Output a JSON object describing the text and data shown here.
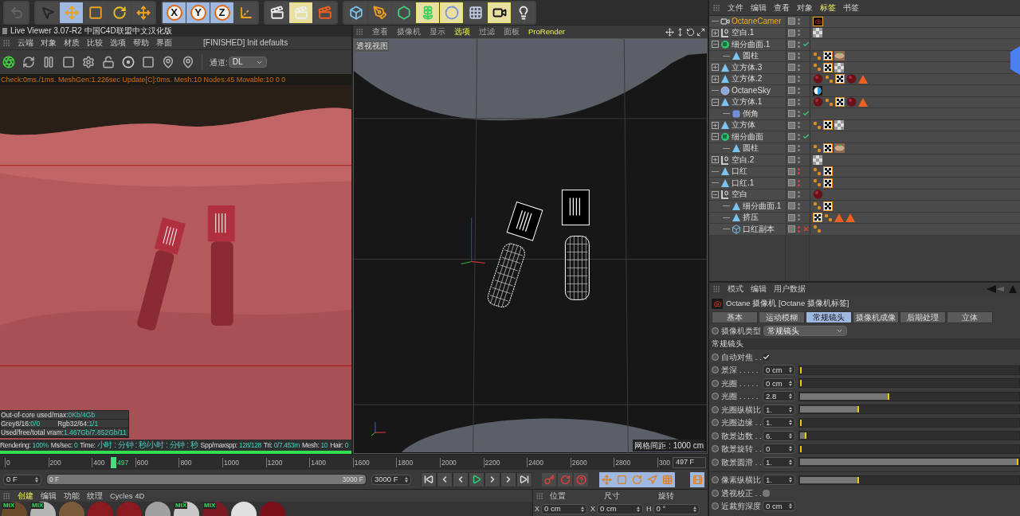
{
  "toolbar": {
    "groups": [
      [
        {
          "kind": "undo",
          "selected": false
        }
      ],
      [
        {
          "kind": "cursor",
          "selected": false
        },
        {
          "kind": "move",
          "selected": true
        },
        {
          "kind": "scale",
          "selected": false
        },
        {
          "kind": "rotate",
          "selected": false
        },
        {
          "kind": "move",
          "selected": false
        }
      ],
      [
        {
          "kind": "axis",
          "label": "X",
          "selected": true
        },
        {
          "kind": "axis",
          "label": "Y",
          "selected": true
        },
        {
          "kind": "axis",
          "label": "Z",
          "selected": true
        },
        {
          "kind": "coords",
          "selected": false
        }
      ],
      [
        {
          "kind": "render",
          "selected": false
        },
        {
          "kind": "render",
          "selected": true
        },
        {
          "kind": "render-settings",
          "selected": false
        }
      ],
      [
        {
          "kind": "cube",
          "selected": false
        },
        {
          "kind": "pen",
          "selected": false
        },
        {
          "kind": "subdivide",
          "selected": false
        },
        {
          "kind": "array",
          "selected": true
        },
        {
          "kind": "deformer",
          "selected": true
        },
        {
          "kind": "floor",
          "selected": false
        },
        {
          "kind": "camera",
          "selected": true
        },
        {
          "kind": "light",
          "selected": false
        }
      ]
    ]
  },
  "live_viewer": {
    "title": "Live Viewer 3.07-R2 中国C4D联盟中文汉化版",
    "menu": [
      "云端",
      "对象",
      "材质",
      "比较",
      "选项",
      "帮助",
      "界面"
    ],
    "status": "[FINISHED] Init defaults",
    "channel": {
      "label": "通道:",
      "value": "DL"
    },
    "stats": "Check:0ms./1ms. MeshGen:1.226sec Update[C]:0ms. Mesh:10 Nodes:45 Movable:10  0 0",
    "overlay": [
      [
        {
          "label": "Out-of-core used/max:",
          "value": "0Kb/4Gb"
        }
      ],
      [
        {
          "label": "Grey8/16:",
          "value": "0/0"
        },
        {
          "label": "Rgb32/64:",
          "value": "1/1"
        }
      ],
      [
        {
          "label": "Used/free/total vram:",
          "value": "1.467Gb/7.852Gb/11"
        }
      ]
    ],
    "status_bar": [
      {
        "label": "Rendering:",
        "value": "100%"
      },
      {
        "label": "Ms/sec:",
        "value": "0"
      },
      {
        "label": "Time:",
        "value": "小时 : 分钟 : 秒/小时 : 分钟 : 秒"
      },
      {
        "label": "Spp/maxspp:",
        "value": "128/128"
      },
      {
        "label": "Tri:",
        "value": "0/7.453m"
      },
      {
        "label": "Mesh:",
        "value": "10"
      },
      {
        "label": "Hair:",
        "value": "0"
      }
    ],
    "progress": {
      "level": 1
    }
  },
  "viewport": {
    "menu": [
      {
        "label": "查看",
        "highlighted": false
      },
      {
        "label": "摄像机",
        "highlighted": false
      },
      {
        "label": "显示",
        "highlighted": false
      },
      {
        "label": "选项",
        "highlighted": true
      },
      {
        "label": "过滤",
        "highlighted": false
      },
      {
        "label": "面板",
        "highlighted": false
      },
      {
        "label": "ProRender",
        "highlighted": true
      }
    ],
    "view_name": "透视视图",
    "grid_spacing": "网格间距 : 1000 cm"
  },
  "objects": {
    "menu": [
      {
        "label": "文件",
        "selected": false
      },
      {
        "label": "编辑",
        "selected": false
      },
      {
        "label": "查看",
        "selected": false
      },
      {
        "label": "对象",
        "selected": false
      },
      {
        "label": "标签",
        "selected": true
      },
      {
        "label": "书签",
        "selected": false
      }
    ],
    "items": [
      {
        "name": "OctaneCamer",
        "kind": "camera",
        "selected": true,
        "hidden": false,
        "tags": [
          {
            "kind": "camera"
          }
        ]
      },
      {
        "name": "空白.1",
        "kind": "null",
        "expanded": false,
        "selected": false,
        "hidden": false,
        "tags": [
          {
            "kind": "checker-grey"
          }
        ]
      },
      {
        "name": "细分曲面.1",
        "kind": "subdiv",
        "expanded": true,
        "enabled": true,
        "selected": false,
        "hidden": false,
        "children": [
          {
            "name": "圆柱",
            "kind": "poly",
            "selected": false,
            "hidden": false,
            "tags": [
              {
                "kind": "dots"
              },
              {
                "kind": "checker"
              },
              {
                "kind": "material-brown"
              }
            ]
          }
        ]
      },
      {
        "name": "立方体.3",
        "kind": "poly",
        "expanded": false,
        "selected": false,
        "hidden": false,
        "tags": [
          {
            "kind": "dots"
          },
          {
            "kind": "checker"
          },
          {
            "kind": "checker-grey"
          }
        ]
      },
      {
        "name": "立方体.2",
        "kind": "poly",
        "expanded": false,
        "selected": false,
        "hidden": false,
        "tags": [
          {
            "kind": "sphere-red"
          },
          {
            "kind": "dots"
          },
          {
            "kind": "checker"
          },
          {
            "kind": "sphere-red"
          },
          {
            "kind": "triangle"
          }
        ]
      },
      {
        "name": "OctaneSky",
        "kind": "sky",
        "selected": false,
        "hidden": false,
        "tags": [
          {
            "kind": "sky"
          }
        ]
      },
      {
        "name": "立方体.1",
        "kind": "poly",
        "expanded": true,
        "selected": false,
        "hidden": false,
        "tags": [
          {
            "kind": "sphere-red"
          },
          {
            "kind": "dots"
          },
          {
            "kind": "checker"
          },
          {
            "kind": "sphere-red"
          },
          {
            "kind": "triangle"
          }
        ],
        "children": [
          {
            "name": "倒角",
            "kind": "bevel",
            "enabled": true,
            "selected": false,
            "hidden": false
          }
        ]
      },
      {
        "name": "立方体",
        "kind": "poly",
        "expanded": false,
        "selected": false,
        "hidden": false,
        "tags": [
          {
            "kind": "dots"
          },
          {
            "kind": "checker"
          },
          {
            "kind": "checker-grey"
          }
        ]
      },
      {
        "name": "细分曲面",
        "kind": "subdiv",
        "expanded": true,
        "enabled": true,
        "selected": false,
        "hidden": false,
        "children": [
          {
            "name": "圆柱",
            "kind": "poly",
            "selected": false,
            "hidden": false,
            "tags": [
              {
                "kind": "dots"
              },
              {
                "kind": "checker"
              },
              {
                "kind": "material-brown"
              }
            ]
          }
        ]
      },
      {
        "name": "空白.2",
        "kind": "null",
        "expanded": false,
        "selected": false,
        "hidden": false,
        "tags": [
          {
            "kind": "checker-grey"
          }
        ]
      },
      {
        "name": "口红",
        "kind": "poly",
        "selected": false,
        "hidden": true,
        "tags": [
          {
            "kind": "dots"
          },
          {
            "kind": "checker"
          }
        ]
      },
      {
        "name": "口红.1",
        "kind": "poly",
        "selected": false,
        "hidden": true,
        "tags": [
          {
            "kind": "dots"
          },
          {
            "kind": "checker"
          }
        ]
      },
      {
        "name": "空白",
        "kind": "null",
        "expanded": true,
        "selected": false,
        "hidden": false,
        "tags": [
          {
            "kind": "sphere-red"
          }
        ],
        "children": [
          {
            "name": "细分曲面.1",
            "kind": "poly",
            "selected": false,
            "hidden": false,
            "tags": [
              {
                "kind": "dots"
              },
              {
                "kind": "checker"
              }
            ]
          },
          {
            "name": "挤压",
            "kind": "poly",
            "selected": false,
            "hidden": false,
            "tags": [
              {
                "kind": "checker"
              },
              {
                "kind": "dots"
              },
              {
                "kind": "triangle"
              },
              {
                "kind": "triangle"
              }
            ]
          },
          {
            "name": "口红副本",
            "kind": "cube",
            "enabled": false,
            "selected": false,
            "hidden": true,
            "tags": [
              {
                "kind": "dots"
              }
            ]
          }
        ]
      }
    ]
  },
  "attributes": {
    "menu": [
      "模式",
      "编辑",
      "用户数据"
    ],
    "title": "Octane 摄像机 [Octane 摄像机标签]",
    "tabs": [
      {
        "label": "基本",
        "selected": false
      },
      {
        "label": "运动模糊",
        "selected": false
      },
      {
        "label": "常规镜头",
        "selected": true
      },
      {
        "label": "摄像机成像",
        "selected": false
      },
      {
        "label": "后期处理",
        "selected": false
      },
      {
        "label": "立体",
        "selected": false
      }
    ],
    "camera_type": {
      "label": "摄像机类型",
      "value": "常规镜头"
    },
    "section": "常规镜头",
    "params": [
      {
        "kind": "checkbox",
        "label": "自动对焦 . .",
        "checked": true
      },
      {
        "kind": "slider",
        "label": "景深 . . . . .",
        "value": "0 cm",
        "level": 0
      },
      {
        "kind": "slider",
        "label": "光圈 . . . . .",
        "value": "0 cm",
        "level": 0
      },
      {
        "kind": "slider",
        "label": "光圈 . . . . .",
        "value": "2.8",
        "level": 0.41
      },
      {
        "kind": "slider",
        "label": "光圈纵横比",
        "value": "1.",
        "level": 0.27
      },
      {
        "kind": "slider",
        "label": "光圈边缘 . .",
        "value": "1.",
        "level": 0
      },
      {
        "kind": "slider",
        "label": "散景边数 . .",
        "value": "6.",
        "level": 0.03
      },
      {
        "kind": "slider",
        "label": "散景旋转 . .",
        "value": "0",
        "level": 0
      },
      {
        "kind": "slider",
        "label": "散景圆滑 . .",
        "value": "1.",
        "level": 1
      },
      {
        "kind": "separator"
      },
      {
        "kind": "slider",
        "label": "像素纵横比",
        "value": "1.",
        "level": 0.27
      },
      {
        "kind": "checkbox",
        "label": "透视校正 . .",
        "checked": false
      },
      {
        "kind": "field",
        "label": "近裁剪深度",
        "value": "0 cm"
      }
    ]
  },
  "timeline": {
    "ruler": [
      "0",
      "200",
      "400",
      "600",
      "800",
      "1000",
      "1200",
      "1400",
      "1600",
      "1800",
      "2000",
      "2200",
      "2400",
      "2600",
      "2800",
      "300"
    ],
    "playhead": {
      "label": "497",
      "level": 0.166
    },
    "current": "497 F",
    "start": "0 F",
    "range": {
      "start": "0 F",
      "end": "3000 F",
      "level": 1
    },
    "end": "3000 F"
  },
  "materials": {
    "menu": [
      {
        "label": "创建",
        "selected": true
      },
      {
        "label": "编辑",
        "selected": false
      },
      {
        "label": "功能",
        "selected": false
      },
      {
        "label": "纹理",
        "selected": false
      },
      {
        "label": "Cycles 4D",
        "selected": false
      }
    ],
    "swatches": [
      {
        "color": "#6b4a2a",
        "label": "MIX"
      },
      {
        "color": "#b5b5b5",
        "label": "MIX"
      },
      {
        "color": "#7a5a3a"
      },
      {
        "color": "#8a1a20"
      },
      {
        "color": "#8a1a20"
      },
      {
        "color": "#a0a0a0"
      },
      {
        "color": "#c8c8c8",
        "label": "MIX"
      },
      {
        "color": "#7a1a22",
        "label": "MIX"
      },
      {
        "color": "#e0e0e0"
      },
      {
        "color": "#7a1018"
      }
    ]
  },
  "coordinates": {
    "headers": [
      "位置",
      "尺寸",
      "旋转"
    ],
    "fields": [
      {
        "axis": "X",
        "value": "0 cm"
      },
      {
        "axis": "X",
        "value": "0 cm"
      },
      {
        "axis": "H",
        "value": "0 °"
      }
    ]
  }
}
